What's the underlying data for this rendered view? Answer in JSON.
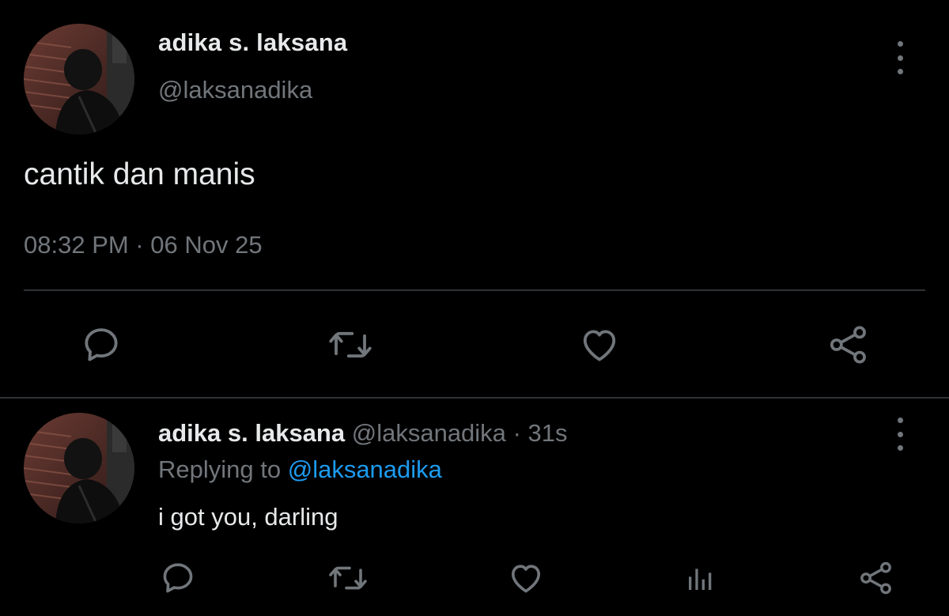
{
  "main_tweet": {
    "author_name": "adika s. laksana",
    "author_handle": "@laksanadika",
    "text": "cantik dan manis",
    "timestamp": "08:32 PM · 06 Nov 25",
    "actions": [
      "reply-icon",
      "retweet-icon",
      "like-icon",
      "share-icon"
    ]
  },
  "reply_tweet": {
    "author_name": "adika s. laksana",
    "author_handle": "@laksanadika",
    "separator": "·",
    "age": "31s",
    "replying_prefix": "Replying to",
    "replying_to": "@laksanadika",
    "text": "i got you, darling",
    "actions": [
      "reply-icon",
      "retweet-icon",
      "like-icon",
      "views-icon",
      "share-icon"
    ]
  },
  "colors": {
    "background": "#000000",
    "primary_text": "#e7e9ea",
    "secondary_text": "#71767b",
    "accent": "#1d9bf0",
    "divider": "#2f3336"
  }
}
